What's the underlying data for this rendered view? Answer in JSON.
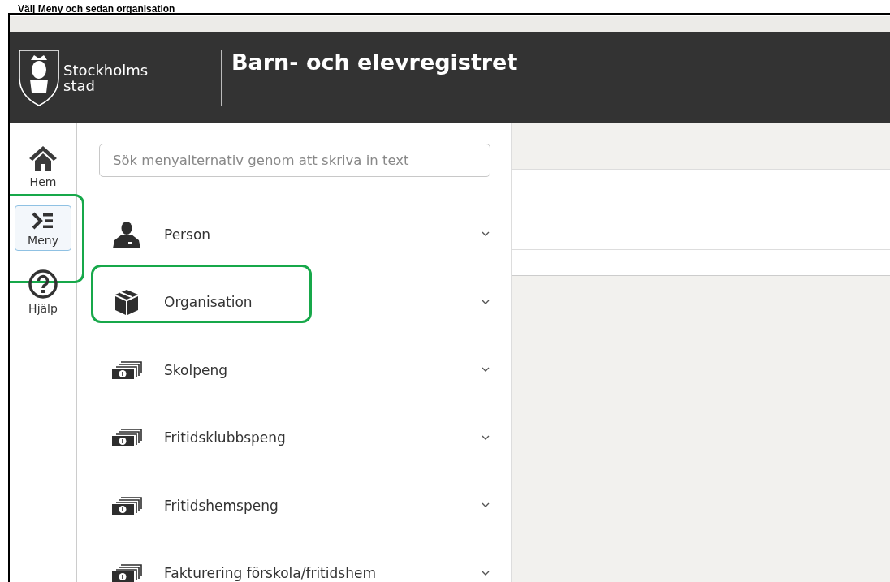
{
  "caption": "Välj Meny och sedan organisation",
  "header": {
    "logo_lines": [
      "Stockholms",
      "stad"
    ],
    "title": "Barn- och elevregistret"
  },
  "rail": [
    {
      "label": "Hem",
      "kind": "home",
      "selected": false,
      "highlighted": false
    },
    {
      "label": "Meny",
      "kind": "menu",
      "selected": true,
      "highlighted": true
    },
    {
      "label": "Hjälp",
      "kind": "help",
      "selected": false,
      "highlighted": false
    }
  ],
  "search": {
    "placeholder": "Sök menyalternativ genom att skriva in text"
  },
  "menu": [
    {
      "label": "Person",
      "kind": "person",
      "expanded": false,
      "highlighted": false
    },
    {
      "label": "Organisation",
      "kind": "box",
      "expanded": false,
      "highlighted": true
    },
    {
      "label": "Skolpeng",
      "kind": "money",
      "expanded": false,
      "highlighted": false
    },
    {
      "label": "Fritidsklubbspeng",
      "kind": "money",
      "expanded": false,
      "highlighted": false
    },
    {
      "label": "Fritidshemspeng",
      "kind": "money",
      "expanded": false,
      "highlighted": false
    },
    {
      "label": "Fakturering förskola/fritidshem",
      "kind": "money",
      "expanded": false,
      "highlighted": false
    }
  ]
}
